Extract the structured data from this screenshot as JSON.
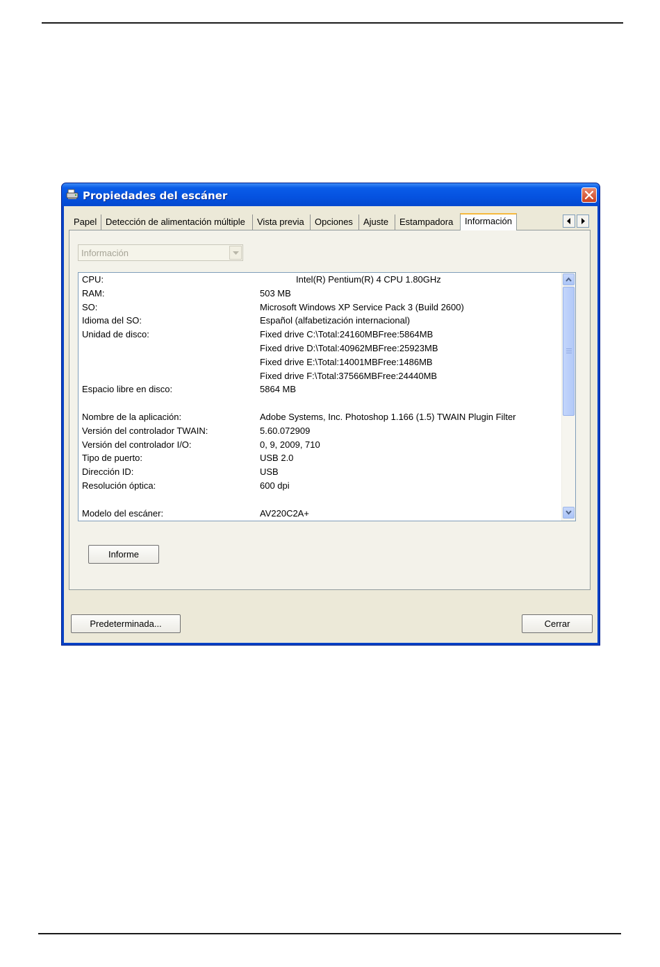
{
  "window": {
    "title": "Propiedades del escáner",
    "title_icon": "scanner-icon",
    "close_icon": "close-icon"
  },
  "tabs": [
    {
      "label": "Papel",
      "active": false
    },
    {
      "label": "Detección de alimentación múltiple",
      "active": false
    },
    {
      "label": "Vista previa",
      "active": false
    },
    {
      "label": "Opciones",
      "active": false
    },
    {
      "label": "Ajuste",
      "active": false
    },
    {
      "label": "Estampadora",
      "active": false
    },
    {
      "label": "Información",
      "active": true
    }
  ],
  "tab_scroll": {
    "left_icon": "arrow-left-icon",
    "right_icon": "arrow-right-icon"
  },
  "combo": {
    "value": "Información",
    "disabled": true
  },
  "info": {
    "rows": [
      {
        "label": "CPU:",
        "value": "Intel(R) Pentium(R) 4 CPU 1.80GHz"
      },
      {
        "label": "RAM:",
        "value": "503 MB"
      },
      {
        "label": "SO:",
        "value": "Microsoft Windows XP Service Pack 3 (Build 2600)"
      },
      {
        "label": "Idioma del SO:",
        "value": "Español (alfabetización internacional)"
      },
      {
        "label": "Unidad de disco:",
        "value": "Fixed drive C:\\Total:24160MBFree:5864MB"
      },
      {
        "label": "",
        "value": "Fixed drive D:\\Total:40962MBFree:25923MB"
      },
      {
        "label": "",
        "value": "Fixed drive E:\\Total:14001MBFree:1486MB"
      },
      {
        "label": "",
        "value": "Fixed drive F:\\Total:37566MBFree:24440MB"
      },
      {
        "label": "Espacio libre en disco:",
        "value": "5864 MB"
      },
      {
        "label": "",
        "value": ""
      },
      {
        "label": "Nombre de la aplicación:",
        "value": "Adobe Systems, Inc. Photoshop 1.166 (1.5) TWAIN Plugin Filter"
      },
      {
        "label": "Versión del controlador TWAIN:",
        "value": "5.60.072909"
      },
      {
        "label": "Versión del controlador I/O:",
        "value": "0, 9, 2009, 710"
      },
      {
        "label": "Tipo de puerto:",
        "value": "USB 2.0"
      },
      {
        "label": "Dirección ID:",
        "value": "USB"
      },
      {
        "label": "Resolución óptica:",
        "value": "600 dpi"
      },
      {
        "label": "",
        "value": ""
      },
      {
        "label": "Modelo del escáner:",
        "value": "AV220C2A+"
      }
    ]
  },
  "buttons": {
    "report": "Informe",
    "default": "Predeterminada...",
    "close": "Cerrar"
  },
  "colors": {
    "title_bar": "#0552e0",
    "dialog_face": "#ece9d8",
    "active_tab_accent": "#f5b93d",
    "close_button": "#c9401f"
  }
}
